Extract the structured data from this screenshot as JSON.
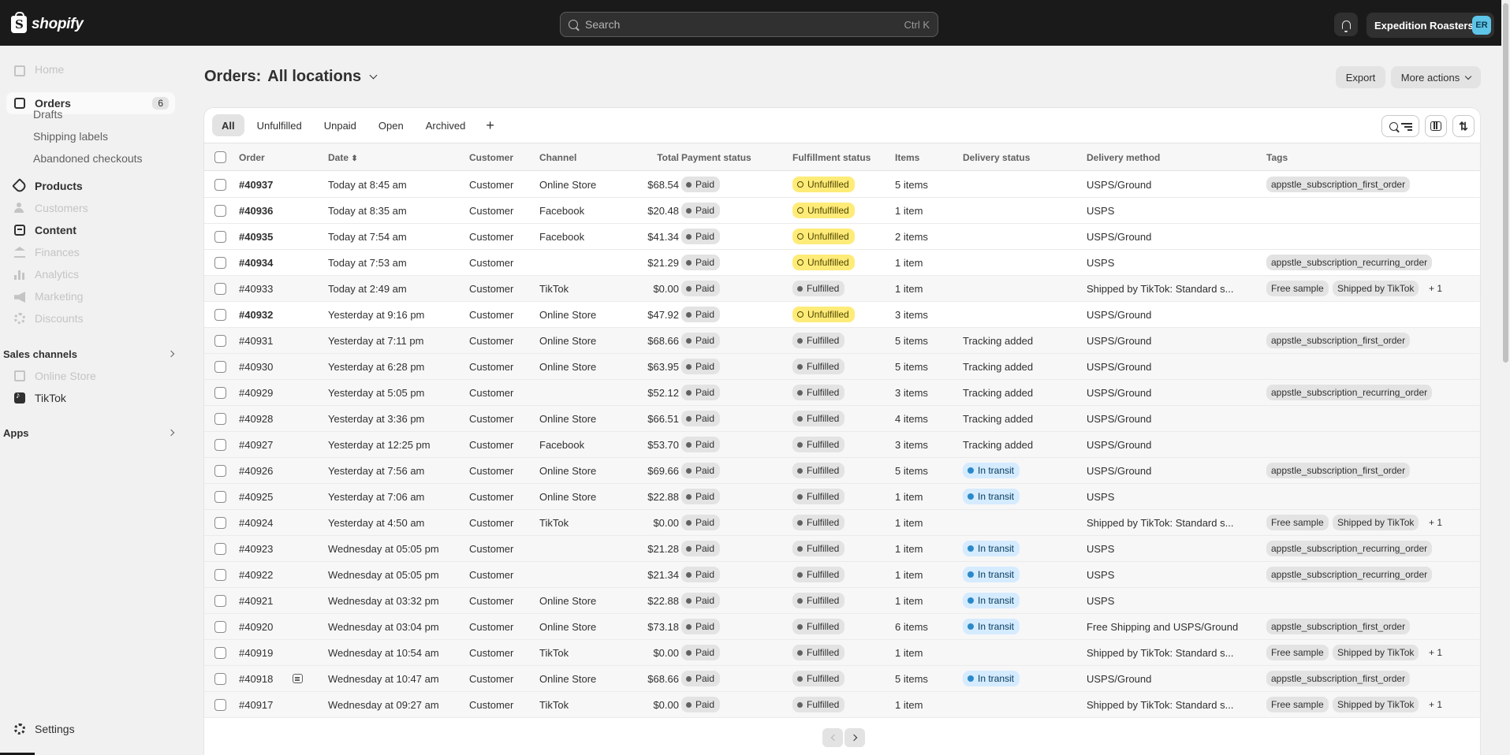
{
  "topbar": {
    "logo_text": "shopify",
    "search_placeholder": "Search",
    "search_shortcut": "Ctrl K",
    "store_name": "Expedition Roasters",
    "avatar_initials": "ER"
  },
  "sidebar": {
    "home": "Home",
    "orders": "Orders",
    "orders_count": "6",
    "drafts": "Drafts",
    "shipping_labels": "Shipping labels",
    "abandoned_checkouts": "Abandoned checkouts",
    "products": "Products",
    "customers": "Customers",
    "content": "Content",
    "finances": "Finances",
    "analytics": "Analytics",
    "marketing": "Marketing",
    "discounts": "Discounts",
    "sales_channels": "Sales channels",
    "online_store": "Online Store",
    "tiktok": "TikTok",
    "apps": "Apps",
    "settings": "Settings"
  },
  "header": {
    "title_prefix": "Orders:",
    "title_location": "All locations",
    "export": "Export",
    "more_actions": "More actions"
  },
  "tabs": [
    "All",
    "Unfulfilled",
    "Unpaid",
    "Open",
    "Archived",
    "+"
  ],
  "columns": {
    "order": "Order",
    "date": "Date",
    "customer": "Customer",
    "channel": "Channel",
    "total": "Total",
    "payment": "Payment status",
    "fulfillment": "Fulfillment status",
    "items": "Items",
    "delivery_status": "Delivery status",
    "delivery_method": "Delivery method",
    "tags": "Tags"
  },
  "orders": [
    {
      "id": "#40937",
      "date": "Today at 8:45 am",
      "customer": "Customer",
      "channel": "Online Store",
      "total": "$68.54",
      "payment": "Paid",
      "fulfillment": "Unfulfilled",
      "items": "5 items",
      "delivery_status": "",
      "delivery_method": "USPS/Ground",
      "tags": [
        "appstle_subscription_first_order"
      ],
      "more": "",
      "unread": true
    },
    {
      "id": "#40936",
      "date": "Today at 8:35 am",
      "customer": "Customer",
      "channel": "Facebook",
      "total": "$20.48",
      "payment": "Paid",
      "fulfillment": "Unfulfilled",
      "items": "1 item",
      "delivery_status": "",
      "delivery_method": "USPS",
      "tags": [],
      "more": "",
      "unread": true
    },
    {
      "id": "#40935",
      "date": "Today at 7:54 am",
      "customer": "Customer",
      "channel": "Facebook",
      "total": "$41.34",
      "payment": "Paid",
      "fulfillment": "Unfulfilled",
      "items": "2 items",
      "delivery_status": "",
      "delivery_method": "USPS/Ground",
      "tags": [],
      "more": "",
      "unread": true
    },
    {
      "id": "#40934",
      "date": "Today at 7:53 am",
      "customer": "Customer",
      "channel": "",
      "total": "$21.29",
      "payment": "Paid",
      "fulfillment": "Unfulfilled",
      "items": "1 item",
      "delivery_status": "",
      "delivery_method": "USPS",
      "tags": [
        "appstle_subscription_recurring_order"
      ],
      "more": "",
      "unread": true
    },
    {
      "id": "#40933",
      "date": "Today at 2:49 am",
      "customer": "Customer",
      "channel": "TikTok",
      "total": "$0.00",
      "payment": "Paid",
      "fulfillment": "Fulfilled",
      "items": "1 item",
      "delivery_status": "",
      "delivery_method": "Shipped by TikTok: Standard s...",
      "tags": [
        "Free sample",
        "Shipped by TikTok"
      ],
      "more": "+ 1",
      "unread": false
    },
    {
      "id": "#40932",
      "date": "Yesterday at 9:16 pm",
      "customer": "Customer",
      "channel": "Online Store",
      "total": "$47.92",
      "payment": "Paid",
      "fulfillment": "Unfulfilled",
      "items": "3 items",
      "delivery_status": "",
      "delivery_method": "USPS/Ground",
      "tags": [],
      "more": "",
      "unread": true
    },
    {
      "id": "#40931",
      "date": "Yesterday at 7:11 pm",
      "customer": "Customer",
      "channel": "Online Store",
      "total": "$68.66",
      "payment": "Paid",
      "fulfillment": "Fulfilled",
      "items": "5 items",
      "delivery_status": "Tracking added",
      "delivery_method": "USPS/Ground",
      "tags": [
        "appstle_subscription_first_order"
      ],
      "more": "",
      "unread": false
    },
    {
      "id": "#40930",
      "date": "Yesterday at 6:28 pm",
      "customer": "Customer",
      "channel": "Online Store",
      "total": "$63.95",
      "payment": "Paid",
      "fulfillment": "Fulfilled",
      "items": "5 items",
      "delivery_status": "Tracking added",
      "delivery_method": "USPS/Ground",
      "tags": [],
      "more": "",
      "unread": false
    },
    {
      "id": "#40929",
      "date": "Yesterday at 5:05 pm",
      "customer": "Customer",
      "channel": "",
      "total": "$52.12",
      "payment": "Paid",
      "fulfillment": "Fulfilled",
      "items": "3 items",
      "delivery_status": "Tracking added",
      "delivery_method": "USPS/Ground",
      "tags": [
        "appstle_subscription_recurring_order"
      ],
      "more": "",
      "unread": false
    },
    {
      "id": "#40928",
      "date": "Yesterday at 3:36 pm",
      "customer": "Customer",
      "channel": "Online Store",
      "total": "$66.51",
      "payment": "Paid",
      "fulfillment": "Fulfilled",
      "items": "4 items",
      "delivery_status": "Tracking added",
      "delivery_method": "USPS/Ground",
      "tags": [],
      "more": "",
      "unread": false
    },
    {
      "id": "#40927",
      "date": "Yesterday at 12:25 pm",
      "customer": "Customer",
      "channel": "Facebook",
      "total": "$53.70",
      "payment": "Paid",
      "fulfillment": "Fulfilled",
      "items": "3 items",
      "delivery_status": "Tracking added",
      "delivery_method": "USPS/Ground",
      "tags": [],
      "more": "",
      "unread": false
    },
    {
      "id": "#40926",
      "date": "Yesterday at 7:56 am",
      "customer": "Customer",
      "channel": "Online Store",
      "total": "$69.66",
      "payment": "Paid",
      "fulfillment": "Fulfilled",
      "items": "5 items",
      "delivery_status": "In transit",
      "delivery_method": "USPS/Ground",
      "tags": [
        "appstle_subscription_first_order"
      ],
      "more": "",
      "unread": false
    },
    {
      "id": "#40925",
      "date": "Yesterday at 7:06 am",
      "customer": "Customer",
      "channel": "Online Store",
      "total": "$22.88",
      "payment": "Paid",
      "fulfillment": "Fulfilled",
      "items": "1 item",
      "delivery_status": "In transit",
      "delivery_method": "USPS",
      "tags": [],
      "more": "",
      "unread": false
    },
    {
      "id": "#40924",
      "date": "Yesterday at 4:50 am",
      "customer": "Customer",
      "channel": "TikTok",
      "total": "$0.00",
      "payment": "Paid",
      "fulfillment": "Fulfilled",
      "items": "1 item",
      "delivery_status": "",
      "delivery_method": "Shipped by TikTok: Standard s...",
      "tags": [
        "Free sample",
        "Shipped by TikTok"
      ],
      "more": "+ 1",
      "unread": false
    },
    {
      "id": "#40923",
      "date": "Wednesday at 05:05 pm",
      "customer": "Customer",
      "channel": "",
      "total": "$21.28",
      "payment": "Paid",
      "fulfillment": "Fulfilled",
      "items": "1 item",
      "delivery_status": "In transit",
      "delivery_method": "USPS",
      "tags": [
        "appstle_subscription_recurring_order"
      ],
      "more": "",
      "unread": false
    },
    {
      "id": "#40922",
      "date": "Wednesday at 05:05 pm",
      "customer": "Customer",
      "channel": "",
      "total": "$21.34",
      "payment": "Paid",
      "fulfillment": "Fulfilled",
      "items": "1 item",
      "delivery_status": "In transit",
      "delivery_method": "USPS",
      "tags": [
        "appstle_subscription_recurring_order"
      ],
      "more": "",
      "unread": false
    },
    {
      "id": "#40921",
      "date": "Wednesday at 03:32 pm",
      "customer": "Customer",
      "channel": "Online Store",
      "total": "$22.88",
      "payment": "Paid",
      "fulfillment": "Fulfilled",
      "items": "1 item",
      "delivery_status": "In transit",
      "delivery_method": "USPS",
      "tags": [],
      "more": "",
      "unread": false
    },
    {
      "id": "#40920",
      "date": "Wednesday at 03:04 pm",
      "customer": "Customer",
      "channel": "Online Store",
      "total": "$73.18",
      "payment": "Paid",
      "fulfillment": "Fulfilled",
      "items": "6 items",
      "delivery_status": "In transit",
      "delivery_method": "Free Shipping and USPS/Ground",
      "tags": [
        "appstle_subscription_first_order"
      ],
      "more": "",
      "unread": false
    },
    {
      "id": "#40919",
      "date": "Wednesday at 10:54 am",
      "customer": "Customer",
      "channel": "TikTok",
      "total": "$0.00",
      "payment": "Paid",
      "fulfillment": "Fulfilled",
      "items": "1 item",
      "delivery_status": "",
      "delivery_method": "Shipped by TikTok: Standard s...",
      "tags": [
        "Free sample",
        "Shipped by TikTok"
      ],
      "more": "+ 1",
      "unread": false
    },
    {
      "id": "#40918",
      "date": "Wednesday at 10:47 am",
      "customer": "Customer",
      "channel": "Online Store",
      "total": "$68.66",
      "payment": "Paid",
      "fulfillment": "Fulfilled",
      "items": "5 items",
      "delivery_status": "In transit",
      "delivery_method": "USPS/Ground",
      "tags": [
        "appstle_subscription_first_order"
      ],
      "more": "",
      "unread": false,
      "note": true
    },
    {
      "id": "#40917",
      "date": "Wednesday at 09:27 am",
      "customer": "Customer",
      "channel": "TikTok",
      "total": "$0.00",
      "payment": "Paid",
      "fulfillment": "Fulfilled",
      "items": "1 item",
      "delivery_status": "",
      "delivery_method": "Shipped by TikTok: Standard s...",
      "tags": [
        "Free sample",
        "Shipped by TikTok"
      ],
      "more": "+ 1",
      "unread": false
    }
  ]
}
